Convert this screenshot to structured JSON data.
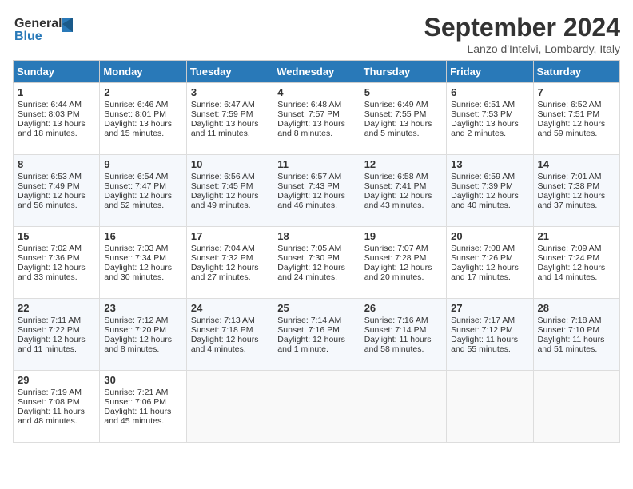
{
  "header": {
    "logo_line1": "General",
    "logo_line2": "Blue",
    "month": "September 2024",
    "location": "Lanzo d'Intelvi, Lombardy, Italy"
  },
  "days_of_week": [
    "Sunday",
    "Monday",
    "Tuesday",
    "Wednesday",
    "Thursday",
    "Friday",
    "Saturday"
  ],
  "weeks": [
    [
      {
        "day": 1,
        "lines": [
          "Sunrise: 6:44 AM",
          "Sunset: 8:03 PM",
          "Daylight: 13 hours",
          "and 18 minutes."
        ]
      },
      {
        "day": 2,
        "lines": [
          "Sunrise: 6:46 AM",
          "Sunset: 8:01 PM",
          "Daylight: 13 hours",
          "and 15 minutes."
        ]
      },
      {
        "day": 3,
        "lines": [
          "Sunrise: 6:47 AM",
          "Sunset: 7:59 PM",
          "Daylight: 13 hours",
          "and 11 minutes."
        ]
      },
      {
        "day": 4,
        "lines": [
          "Sunrise: 6:48 AM",
          "Sunset: 7:57 PM",
          "Daylight: 13 hours",
          "and 8 minutes."
        ]
      },
      {
        "day": 5,
        "lines": [
          "Sunrise: 6:49 AM",
          "Sunset: 7:55 PM",
          "Daylight: 13 hours",
          "and 5 minutes."
        ]
      },
      {
        "day": 6,
        "lines": [
          "Sunrise: 6:51 AM",
          "Sunset: 7:53 PM",
          "Daylight: 13 hours",
          "and 2 minutes."
        ]
      },
      {
        "day": 7,
        "lines": [
          "Sunrise: 6:52 AM",
          "Sunset: 7:51 PM",
          "Daylight: 12 hours",
          "and 59 minutes."
        ]
      }
    ],
    [
      {
        "day": 8,
        "lines": [
          "Sunrise: 6:53 AM",
          "Sunset: 7:49 PM",
          "Daylight: 12 hours",
          "and 56 minutes."
        ]
      },
      {
        "day": 9,
        "lines": [
          "Sunrise: 6:54 AM",
          "Sunset: 7:47 PM",
          "Daylight: 12 hours",
          "and 52 minutes."
        ]
      },
      {
        "day": 10,
        "lines": [
          "Sunrise: 6:56 AM",
          "Sunset: 7:45 PM",
          "Daylight: 12 hours",
          "and 49 minutes."
        ]
      },
      {
        "day": 11,
        "lines": [
          "Sunrise: 6:57 AM",
          "Sunset: 7:43 PM",
          "Daylight: 12 hours",
          "and 46 minutes."
        ]
      },
      {
        "day": 12,
        "lines": [
          "Sunrise: 6:58 AM",
          "Sunset: 7:41 PM",
          "Daylight: 12 hours",
          "and 43 minutes."
        ]
      },
      {
        "day": 13,
        "lines": [
          "Sunrise: 6:59 AM",
          "Sunset: 7:39 PM",
          "Daylight: 12 hours",
          "and 40 minutes."
        ]
      },
      {
        "day": 14,
        "lines": [
          "Sunrise: 7:01 AM",
          "Sunset: 7:38 PM",
          "Daylight: 12 hours",
          "and 37 minutes."
        ]
      }
    ],
    [
      {
        "day": 15,
        "lines": [
          "Sunrise: 7:02 AM",
          "Sunset: 7:36 PM",
          "Daylight: 12 hours",
          "and 33 minutes."
        ]
      },
      {
        "day": 16,
        "lines": [
          "Sunrise: 7:03 AM",
          "Sunset: 7:34 PM",
          "Daylight: 12 hours",
          "and 30 minutes."
        ]
      },
      {
        "day": 17,
        "lines": [
          "Sunrise: 7:04 AM",
          "Sunset: 7:32 PM",
          "Daylight: 12 hours",
          "and 27 minutes."
        ]
      },
      {
        "day": 18,
        "lines": [
          "Sunrise: 7:05 AM",
          "Sunset: 7:30 PM",
          "Daylight: 12 hours",
          "and 24 minutes."
        ]
      },
      {
        "day": 19,
        "lines": [
          "Sunrise: 7:07 AM",
          "Sunset: 7:28 PM",
          "Daylight: 12 hours",
          "and 20 minutes."
        ]
      },
      {
        "day": 20,
        "lines": [
          "Sunrise: 7:08 AM",
          "Sunset: 7:26 PM",
          "Daylight: 12 hours",
          "and 17 minutes."
        ]
      },
      {
        "day": 21,
        "lines": [
          "Sunrise: 7:09 AM",
          "Sunset: 7:24 PM",
          "Daylight: 12 hours",
          "and 14 minutes."
        ]
      }
    ],
    [
      {
        "day": 22,
        "lines": [
          "Sunrise: 7:11 AM",
          "Sunset: 7:22 PM",
          "Daylight: 12 hours",
          "and 11 minutes."
        ]
      },
      {
        "day": 23,
        "lines": [
          "Sunrise: 7:12 AM",
          "Sunset: 7:20 PM",
          "Daylight: 12 hours",
          "and 8 minutes."
        ]
      },
      {
        "day": 24,
        "lines": [
          "Sunrise: 7:13 AM",
          "Sunset: 7:18 PM",
          "Daylight: 12 hours",
          "and 4 minutes."
        ]
      },
      {
        "day": 25,
        "lines": [
          "Sunrise: 7:14 AM",
          "Sunset: 7:16 PM",
          "Daylight: 12 hours",
          "and 1 minute."
        ]
      },
      {
        "day": 26,
        "lines": [
          "Sunrise: 7:16 AM",
          "Sunset: 7:14 PM",
          "Daylight: 11 hours",
          "and 58 minutes."
        ]
      },
      {
        "day": 27,
        "lines": [
          "Sunrise: 7:17 AM",
          "Sunset: 7:12 PM",
          "Daylight: 11 hours",
          "and 55 minutes."
        ]
      },
      {
        "day": 28,
        "lines": [
          "Sunrise: 7:18 AM",
          "Sunset: 7:10 PM",
          "Daylight: 11 hours",
          "and 51 minutes."
        ]
      }
    ],
    [
      {
        "day": 29,
        "lines": [
          "Sunrise: 7:19 AM",
          "Sunset: 7:08 PM",
          "Daylight: 11 hours",
          "and 48 minutes."
        ]
      },
      {
        "day": 30,
        "lines": [
          "Sunrise: 7:21 AM",
          "Sunset: 7:06 PM",
          "Daylight: 11 hours",
          "and 45 minutes."
        ]
      },
      null,
      null,
      null,
      null,
      null
    ]
  ]
}
